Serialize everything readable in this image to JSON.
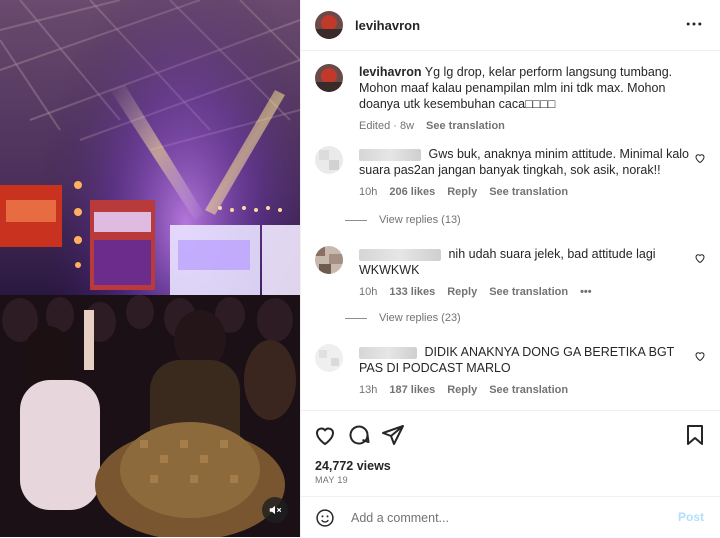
{
  "post": {
    "username": "levihavron",
    "caption_user": "levihavron",
    "caption_text": "Yg lg drop, kelar perform langsung tumbang. Mohon maaf kalau penampilan mlm ini tdk max. Mohon doanya utk kesembuhan caca□□□□",
    "caption_meta_edited": "Edited · 8w",
    "caption_meta_translate": "See translation"
  },
  "comments": [
    {
      "text": "Gws buk, anaknya minim attitude. Minimal kalo suara pas2an jangan banyak tingkah, sok asik, norak!!",
      "time": "10h",
      "likes": "206 likes",
      "reply": "Reply",
      "translate": "See translation",
      "replies": "View replies (13)"
    },
    {
      "text": "nih udah suara jelek, bad attitude lagi WKWKWK",
      "time": "10h",
      "likes": "133 likes",
      "reply": "Reply",
      "translate": "See translation",
      "options": "•••",
      "replies": "View replies (23)"
    },
    {
      "text": "DIDIK ANAKNYA DONG GA BERETIKA BGT PAS DI PODCAST MARLO",
      "time": "13h",
      "likes": "187 likes",
      "reply": "Reply",
      "translate": "See translation"
    }
  ],
  "stats": {
    "views": "24,772 views",
    "date": "MAY 19"
  },
  "add_comment": {
    "placeholder": "Add a comment...",
    "post_label": "Post"
  },
  "icons": {
    "more": "more-options-icon",
    "like": "heart-icon",
    "comment": "comment-icon",
    "share": "share-icon",
    "save": "bookmark-icon",
    "emoji": "emoji-icon",
    "mute": "muted-speaker-icon"
  },
  "colors": {
    "link_blue_disabled": "#b2dffc",
    "meta_gray": "#737373",
    "text": "#262626"
  }
}
